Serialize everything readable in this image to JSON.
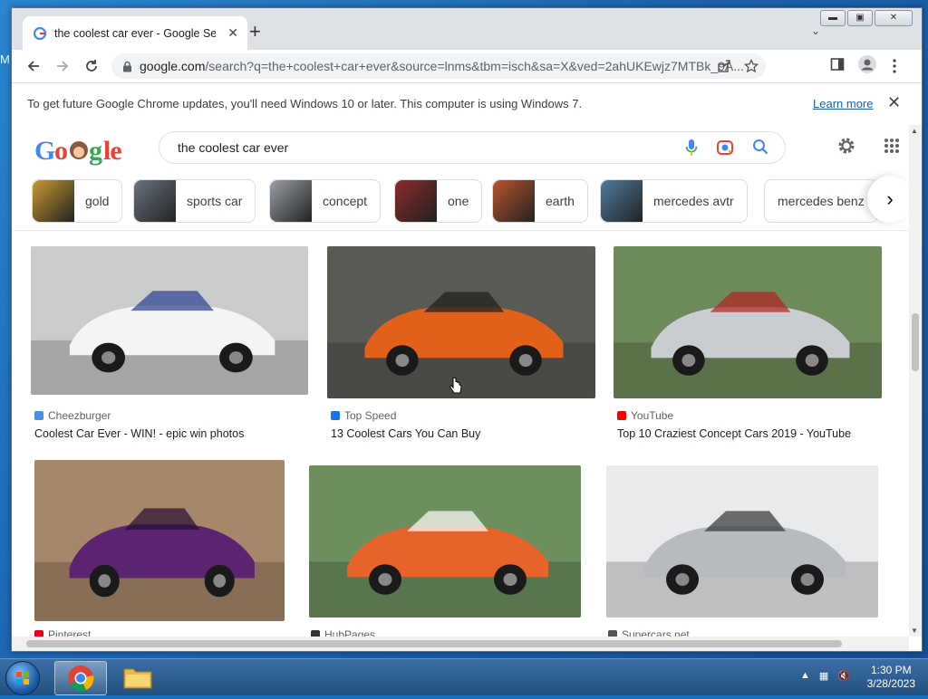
{
  "desktop": {
    "edge_letter": "M"
  },
  "browser": {
    "tab": {
      "title": "the coolest car ever - Google Search",
      "close_label": "✕"
    },
    "new_tab_label": "+",
    "tab_search_label": "⌄",
    "window_controls": {
      "minimize": "▬",
      "maximize": "▣",
      "close": "✕"
    },
    "url": {
      "host": "google.com",
      "path": "/search?q=the+coolest+car+ever&source=lnms&tbm=isch&sa=X&ved=2ahUKEwjz7MTBk_9A..."
    },
    "infobar": {
      "message": "To get future Google Chrome updates, you'll need Windows 10 or later. This computer is using Windows 7.",
      "link": "Learn more",
      "close_label": "✕"
    }
  },
  "search": {
    "logo_text": "Google",
    "query": "the coolest car ever",
    "chips": [
      {
        "label": "gold",
        "color": "#c9992f"
      },
      {
        "label": "sports car",
        "color": "#6b7380"
      },
      {
        "label": "concept",
        "color": "#9aa0a6"
      },
      {
        "label": "one",
        "color": "#8b2a2a"
      },
      {
        "label": "earth",
        "color": "#b8552a"
      },
      {
        "label": "mercedes avtr",
        "color": "#4e7ca1"
      },
      {
        "label": "mercedes benz",
        "color": "#777777"
      }
    ],
    "chip_next_label": "›"
  },
  "results": [
    {
      "source": "Cheezburger",
      "title": "Coolest Car Ever - WIN! - epic win photos",
      "bg": "#c9cbcd",
      "car": "#f4f4f4",
      "accent": "#2b3f8f",
      "src_color": "#4a90e2"
    },
    {
      "source": "Top Speed",
      "title": "13 Coolest Cars You Can Buy",
      "bg": "#5a5a55",
      "car": "#e2601a",
      "accent": "#1c1c1c",
      "src_color": "#1a73e8"
    },
    {
      "source": "YouTube",
      "title": "Top 10 Craziest Concept Cars 2019 - YouTube",
      "bg": "#6f8a5a",
      "car": "#c9ccd1",
      "accent": "#b22222",
      "src_color": "#ff0000"
    },
    {
      "source": "Pinterest",
      "title": "",
      "bg": "#a7876a",
      "car": "#5b2370",
      "accent": "#2a0d38",
      "src_color": "#e60023"
    },
    {
      "source": "HubPages",
      "title": "",
      "bg": "#6d8f5e",
      "car": "#e8632a",
      "accent": "#ffffff",
      "src_color": "#333333"
    },
    {
      "source": "Supercars.net",
      "title": "",
      "bg": "#e9eaec",
      "car": "#b7bbc0",
      "accent": "#333333",
      "src_color": "#555555"
    }
  ],
  "taskbar": {
    "time": "1:30 PM",
    "date": "3/28/2023"
  }
}
